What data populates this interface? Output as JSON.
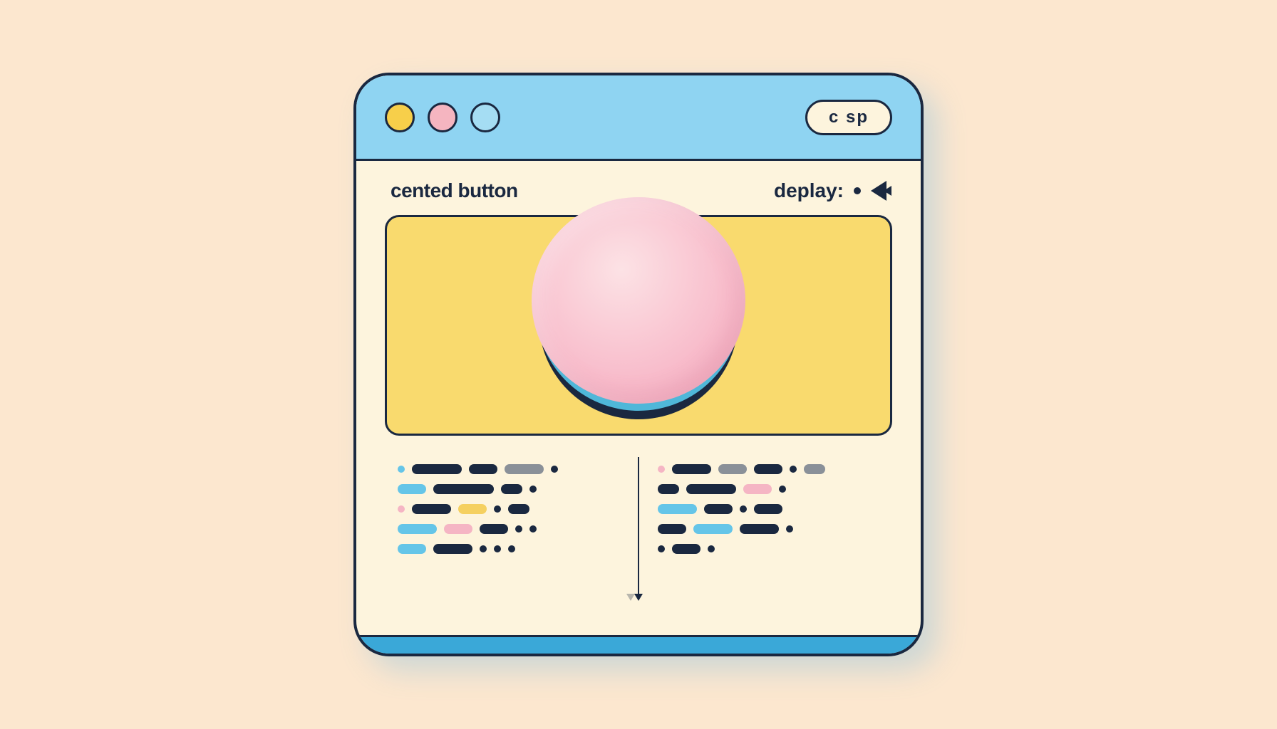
{
  "titlebar": {
    "pill_label": "c sp"
  },
  "labels": {
    "left": "cented button",
    "right": "deplay:"
  },
  "colors": {
    "bg": "#fce7cf",
    "window": "#fdf4dd",
    "titlebar": "#8fd4f2",
    "canvas": "#f9da6e",
    "button_top": "#f8bccb",
    "outline": "#1a2840"
  }
}
